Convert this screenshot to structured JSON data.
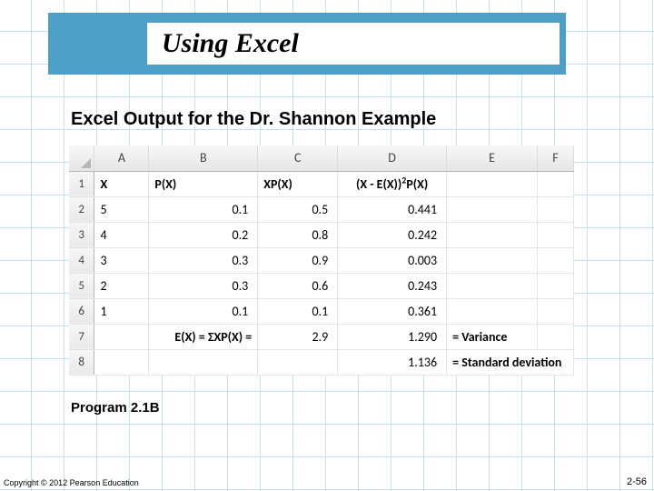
{
  "slide": {
    "title": "Using Excel",
    "subtitle": "Excel Output for the Dr. Shannon Example",
    "program_label": "Program 2.1B",
    "copyright": "Copyright © 2012 Pearson Education",
    "page_label": "2-56"
  },
  "excel": {
    "columns": [
      "A",
      "B",
      "C",
      "D",
      "E",
      "F"
    ],
    "row_numbers": [
      "1",
      "2",
      "3",
      "4",
      "5",
      "6",
      "7",
      "8"
    ],
    "headers": {
      "A": "X",
      "B": "P(X)",
      "C": "XP(X)",
      "D_pre": "(X - E(X))",
      "D_sup": "2",
      "D_post": "P(X)"
    },
    "data": [
      {
        "A": "5",
        "B": "0.1",
        "C": "0.5",
        "D": "0.441"
      },
      {
        "A": "4",
        "B": "0.2",
        "C": "0.8",
        "D": "0.242"
      },
      {
        "A": "3",
        "B": "0.3",
        "C": "0.9",
        "D": "0.003"
      },
      {
        "A": "2",
        "B": "0.3",
        "C": "0.6",
        "D": "0.243"
      },
      {
        "A": "1",
        "B": "0.1",
        "C": "0.1",
        "D": "0.361"
      }
    ],
    "summary": {
      "label": "E(X) =  ΣXP(X) =",
      "C7": "2.9",
      "D7": "1.290",
      "E7": "= Variance",
      "D8": "1.136",
      "E8": "= Standard deviation"
    }
  },
  "chart_data": {
    "type": "table",
    "title": "Dr. Shannon Example — probability distribution",
    "columns": [
      "X",
      "P(X)",
      "XP(X)",
      "(X - E(X))^2 P(X)"
    ],
    "rows": [
      [
        5,
        0.1,
        0.5,
        0.441
      ],
      [
        4,
        0.2,
        0.8,
        0.242
      ],
      [
        3,
        0.3,
        0.9,
        0.003
      ],
      [
        2,
        0.3,
        0.6,
        0.243
      ],
      [
        1,
        0.1,
        0.1,
        0.361
      ]
    ],
    "summary": {
      "E(X)": 2.9,
      "Variance": 1.29,
      "Standard deviation": 1.136
    }
  }
}
